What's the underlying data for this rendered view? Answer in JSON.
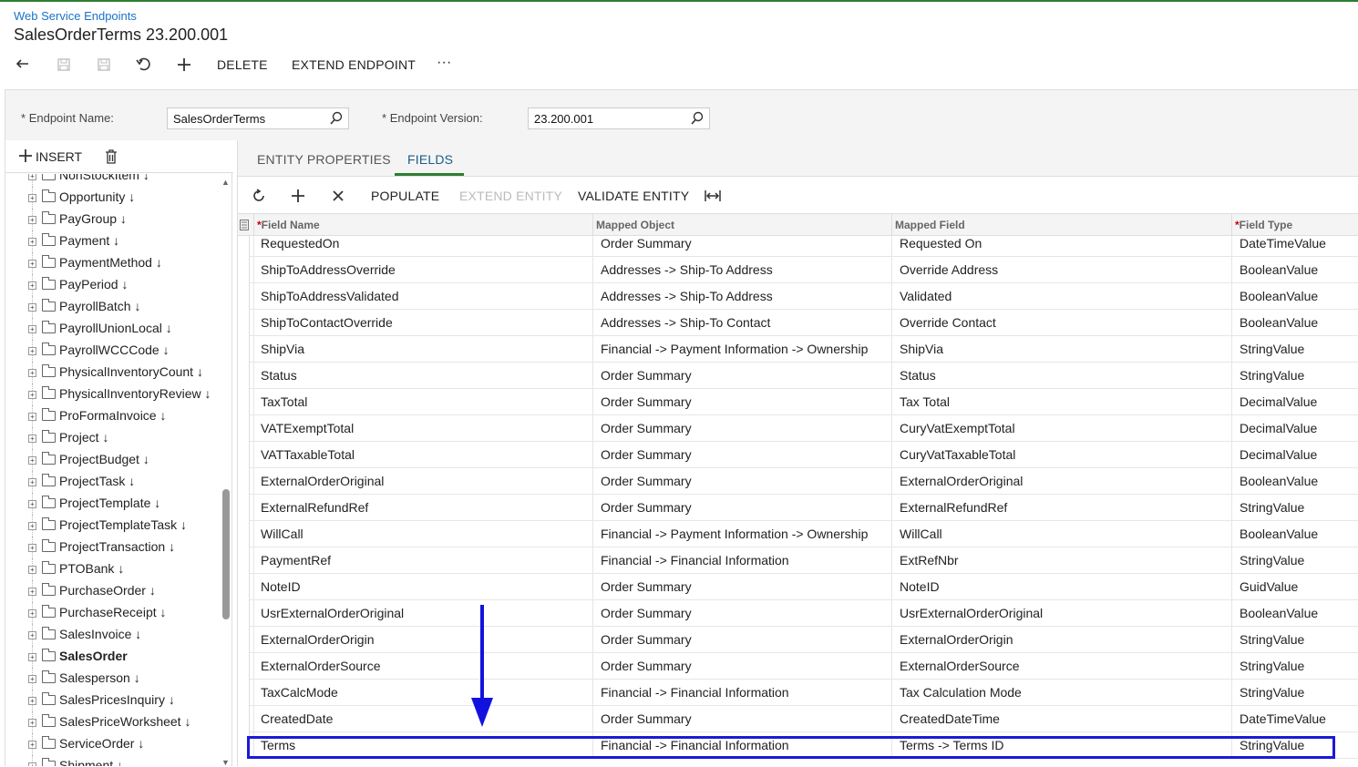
{
  "breadcrumb": "Web Service Endpoints",
  "title": "SalesOrderTerms 23.200.001",
  "toolbar": {
    "icons": [
      "back-arrow-icon",
      "save-close-icon",
      "save-icon",
      "undo-icon",
      "plus-icon"
    ],
    "delete_label": "DELETE",
    "extend_label": "EXTEND ENDPOINT",
    "more_label": "···"
  },
  "header": {
    "endpoint_name_label": "Endpoint Name:",
    "endpoint_name_value": "SalesOrderTerms",
    "endpoint_version_label": "Endpoint Version:",
    "endpoint_version_value": "23.200.001",
    "required_mark": "*"
  },
  "left": {
    "insert_label": "INSERT",
    "tree": [
      {
        "label": "NonStockItem ↓",
        "bold": false
      },
      {
        "label": "Opportunity ↓",
        "bold": false
      },
      {
        "label": "PayGroup ↓",
        "bold": false
      },
      {
        "label": "Payment ↓",
        "bold": false
      },
      {
        "label": "PaymentMethod ↓",
        "bold": false
      },
      {
        "label": "PayPeriod ↓",
        "bold": false
      },
      {
        "label": "PayrollBatch ↓",
        "bold": false
      },
      {
        "label": "PayrollUnionLocal ↓",
        "bold": false
      },
      {
        "label": "PayrollWCCCode ↓",
        "bold": false
      },
      {
        "label": "PhysicalInventoryCount ↓",
        "bold": false
      },
      {
        "label": "PhysicalInventoryReview ↓",
        "bold": false
      },
      {
        "label": "ProFormaInvoice ↓",
        "bold": false
      },
      {
        "label": "Project ↓",
        "bold": false
      },
      {
        "label": "ProjectBudget ↓",
        "bold": false
      },
      {
        "label": "ProjectTask ↓",
        "bold": false
      },
      {
        "label": "ProjectTemplate ↓",
        "bold": false
      },
      {
        "label": "ProjectTemplateTask ↓",
        "bold": false
      },
      {
        "label": "ProjectTransaction ↓",
        "bold": false
      },
      {
        "label": "PTOBank ↓",
        "bold": false
      },
      {
        "label": "PurchaseOrder ↓",
        "bold": false
      },
      {
        "label": "PurchaseReceipt ↓",
        "bold": false
      },
      {
        "label": "SalesInvoice ↓",
        "bold": false
      },
      {
        "label": "SalesOrder",
        "bold": true
      },
      {
        "label": "Salesperson ↓",
        "bold": false
      },
      {
        "label": "SalesPricesInquiry ↓",
        "bold": false
      },
      {
        "label": "SalesPriceWorksheet ↓",
        "bold": false
      },
      {
        "label": "ServiceOrder ↓",
        "bold": false
      },
      {
        "label": "Shipment ↓",
        "bold": false
      }
    ]
  },
  "tabs": {
    "entity_properties": "ENTITY PROPERTIES",
    "fields": "FIELDS"
  },
  "grid_toolbar": {
    "populate": "POPULATE",
    "extend_entity": "EXTEND ENTITY",
    "validate_entity": "VALIDATE ENTITY"
  },
  "grid": {
    "headers": {
      "field_name": "Field Name",
      "mapped_object": "Mapped Object",
      "mapped_field": "Mapped Field",
      "field_type": "Field Type"
    },
    "rows": [
      [
        "RequestedOn",
        "Order Summary",
        "Requested On",
        "DateTimeValue"
      ],
      [
        "ShipToAddressOverride",
        "Addresses -> Ship-To Address",
        "Override Address",
        "BooleanValue"
      ],
      [
        "ShipToAddressValidated",
        "Addresses -> Ship-To Address",
        "Validated",
        "BooleanValue"
      ],
      [
        "ShipToContactOverride",
        "Addresses -> Ship-To Contact",
        "Override Contact",
        "BooleanValue"
      ],
      [
        "ShipVia",
        "Financial -> Payment Information -> Ownership",
        "ShipVia",
        "StringValue"
      ],
      [
        "Status",
        "Order Summary",
        "Status",
        "StringValue"
      ],
      [
        "TaxTotal",
        "Order Summary",
        "Tax Total",
        "DecimalValue"
      ],
      [
        "VATExemptTotal",
        "Order Summary",
        "CuryVatExemptTotal",
        "DecimalValue"
      ],
      [
        "VATTaxableTotal",
        "Order Summary",
        "CuryVatTaxableTotal",
        "DecimalValue"
      ],
      [
        "ExternalOrderOriginal",
        "Order Summary",
        "ExternalOrderOriginal",
        "BooleanValue"
      ],
      [
        "ExternalRefundRef",
        "Order Summary",
        "ExternalRefundRef",
        "StringValue"
      ],
      [
        "WillCall",
        "Financial -> Payment Information -> Ownership",
        "WillCall",
        "BooleanValue"
      ],
      [
        "PaymentRef",
        "Financial -> Financial Information",
        "ExtRefNbr",
        "StringValue"
      ],
      [
        "NoteID",
        "Order Summary",
        "NoteID",
        "GuidValue"
      ],
      [
        "UsrExternalOrderOriginal",
        "Order Summary",
        "UsrExternalOrderOriginal",
        "BooleanValue"
      ],
      [
        "ExternalOrderOrigin",
        "Order Summary",
        "ExternalOrderOrigin",
        "StringValue"
      ],
      [
        "ExternalOrderSource",
        "Order Summary",
        "ExternalOrderSource",
        "StringValue"
      ],
      [
        "TaxCalcMode",
        "Financial -> Financial Information",
        "Tax Calculation Mode",
        "StringValue"
      ],
      [
        "CreatedDate",
        "Order Summary",
        "CreatedDateTime",
        "DateTimeValue"
      ],
      [
        "Terms",
        "Financial -> Financial Information",
        "Terms -> Terms ID",
        "StringValue"
      ]
    ]
  },
  "colors": {
    "accent_green": "#2e7d32",
    "link_blue": "#1a73c8",
    "annotation_blue": "#1212e0"
  }
}
